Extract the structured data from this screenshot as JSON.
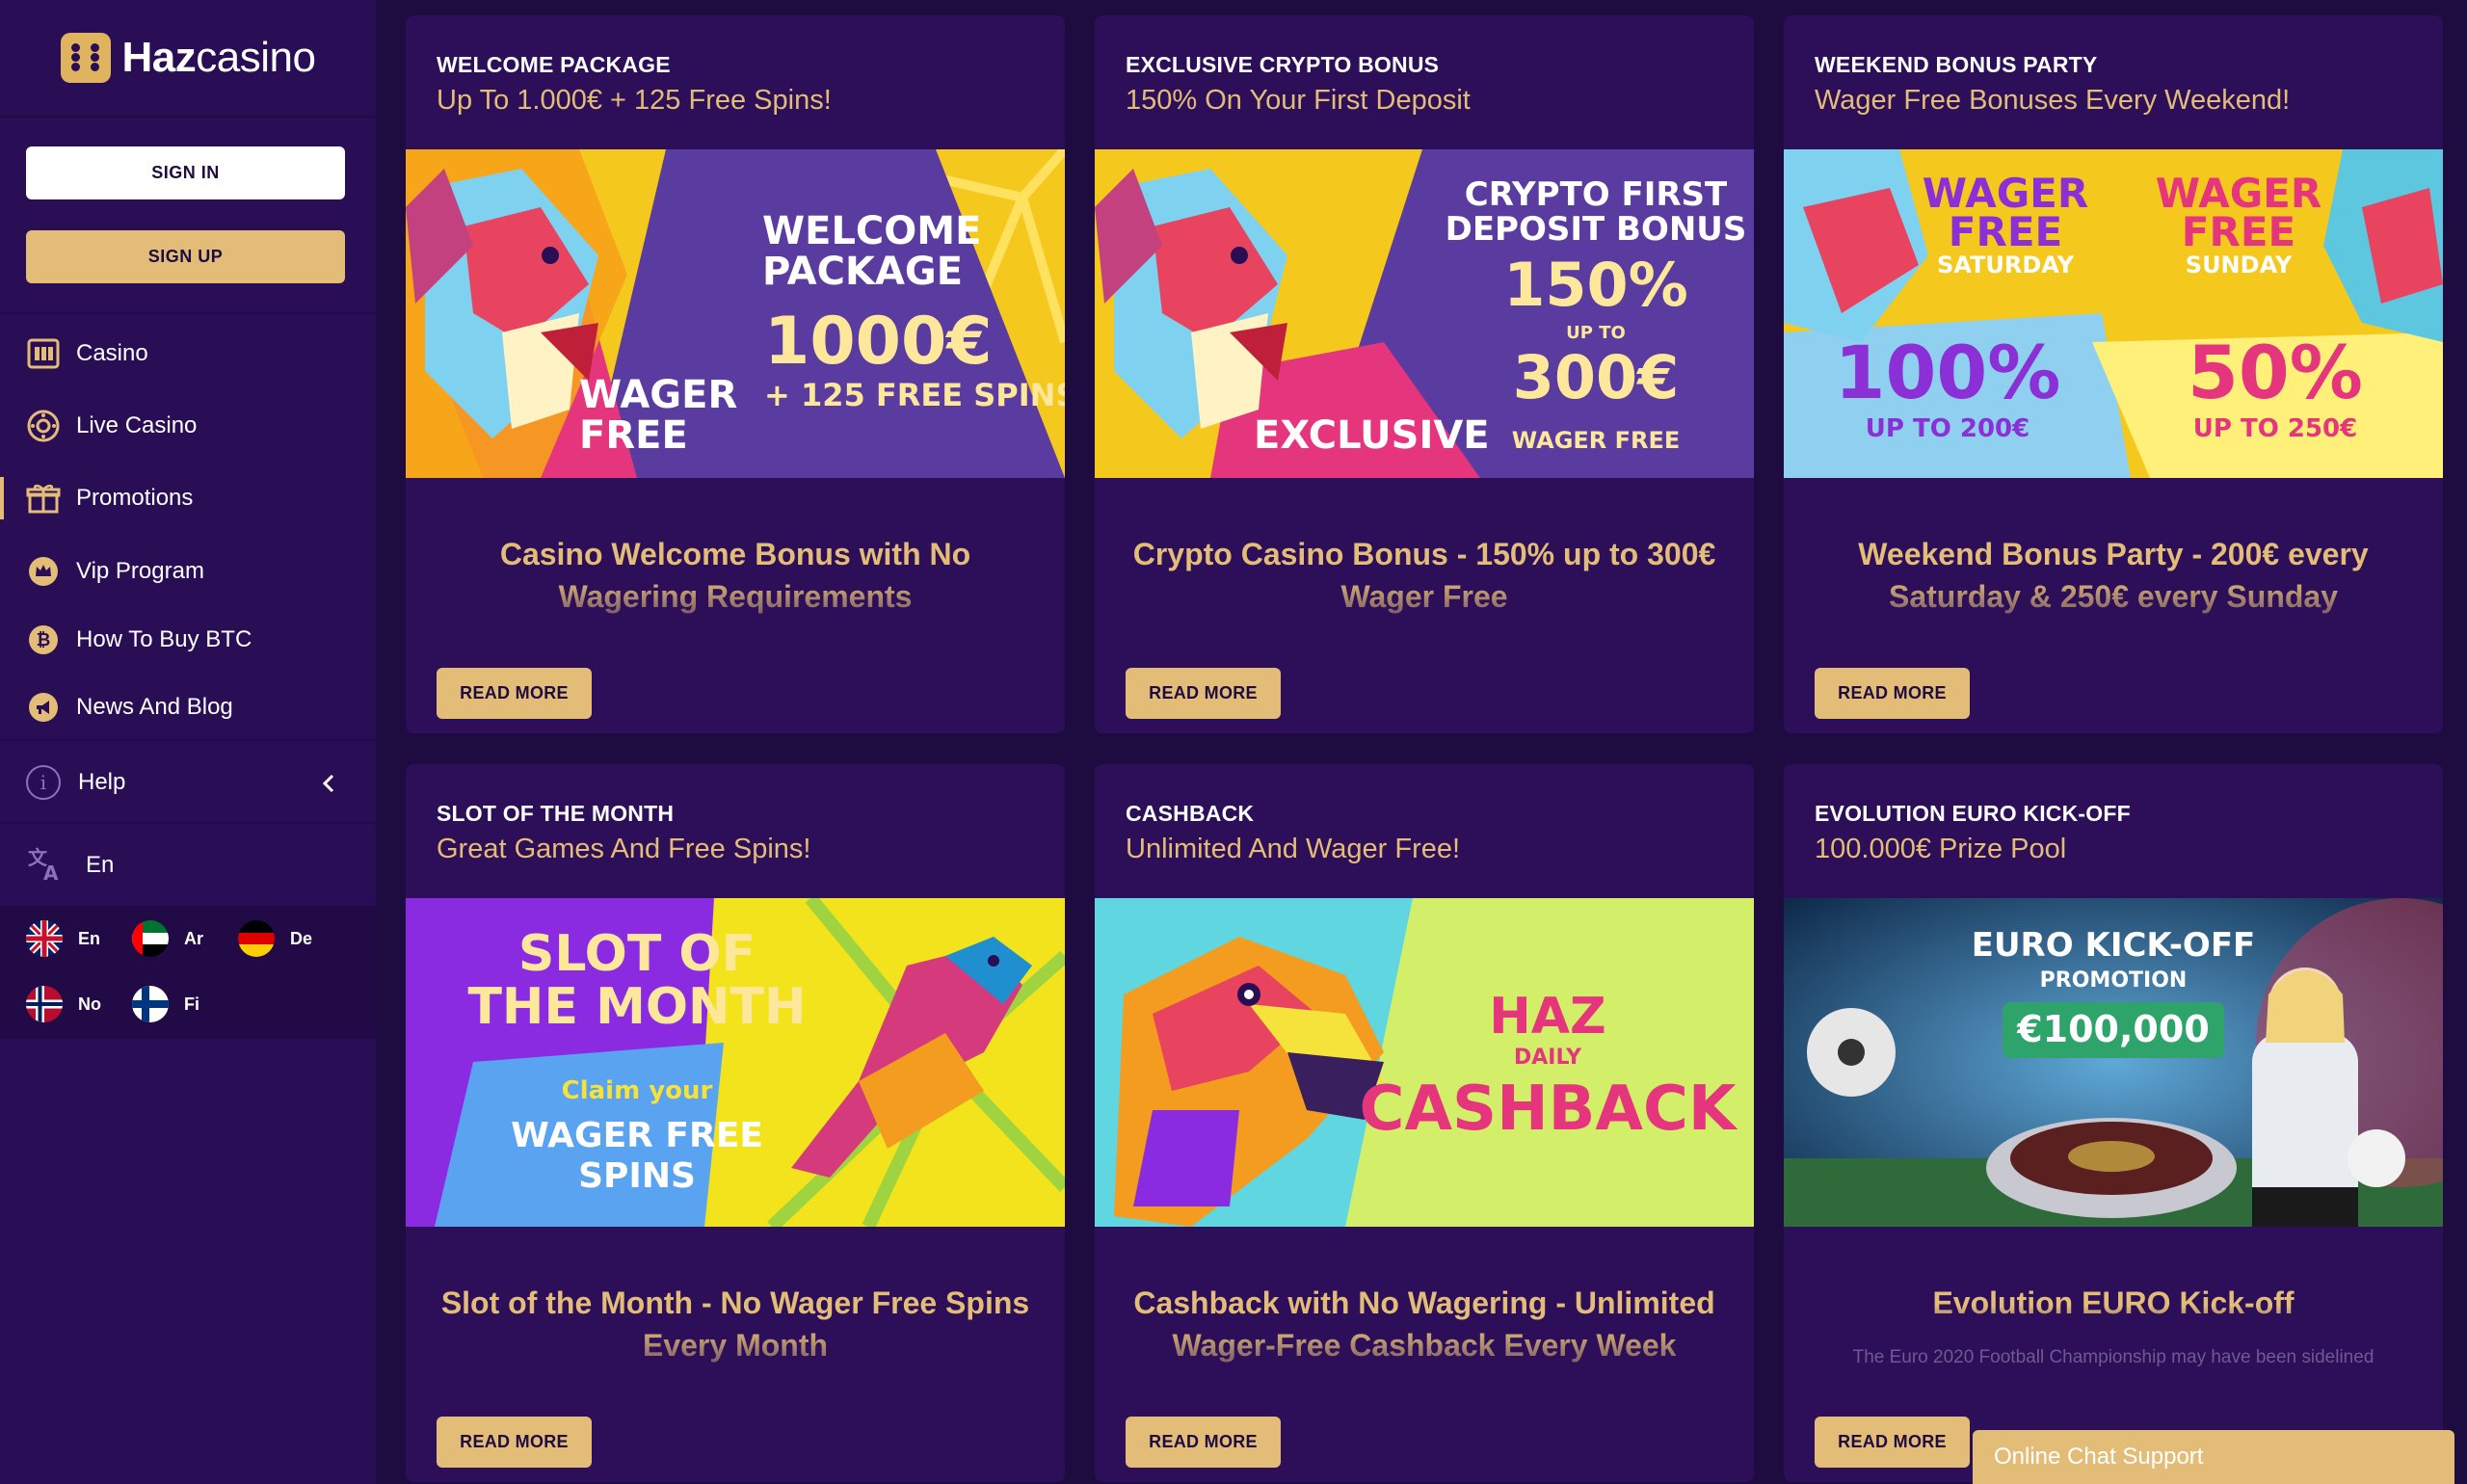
{
  "brand": {
    "name_bold": "Haz",
    "name_light": "casino"
  },
  "auth": {
    "signin": "SIGN IN",
    "signup": "SIGN UP"
  },
  "nav": [
    {
      "label": "Casino",
      "icon": "slot-machine-icon"
    },
    {
      "label": "Live Casino",
      "icon": "roulette-icon"
    },
    {
      "label": "Promotions",
      "icon": "gift-icon",
      "active": true
    },
    {
      "label": "Vip Program",
      "icon": "crown-icon"
    },
    {
      "label": "How To Buy BTC",
      "icon": "bitcoin-icon"
    },
    {
      "label": "News And Blog",
      "icon": "megaphone-icon"
    }
  ],
  "help": {
    "label": "Help",
    "icon_glyph": "i"
  },
  "language": {
    "current": "En"
  },
  "languages": [
    "En",
    "Ar",
    "De",
    "No",
    "Fi"
  ],
  "cards": [
    {
      "label": "WELCOME PACKAGE",
      "subtitle": "Up To 1.000€ + 125 Free Spins!",
      "banner": {
        "l1": "WELCOME",
        "l2": "PACKAGE",
        "l3": "1000€",
        "l4": "+ 125 FREE SPINS",
        "l5": "WAGER",
        "l6": "FREE"
      },
      "title": "Casino Welcome Bonus with No Wagering Requirements",
      "desc": "",
      "button": "READ MORE"
    },
    {
      "label": "EXCLUSIVE CRYPTO BONUS",
      "subtitle": "150% On Your First Deposit",
      "banner": {
        "l1": "CRYPTO FIRST",
        "l2": "DEPOSIT BONUS",
        "l3": "150%",
        "l4": "UP TO",
        "l5": "300€",
        "l6": "WAGER FREE",
        "l7": "EXCLUSIVE"
      },
      "title": "Crypto Casino Bonus - 150% up to 300€ Wager Free",
      "desc": "",
      "button": "READ MORE"
    },
    {
      "label": "WEEKEND BONUS PARTY",
      "subtitle": "Wager Free Bonuses Every Weekend!",
      "banner": {
        "l1": "WAGER",
        "l2": "FREE",
        "l3": "SATURDAY",
        "l4": "SUNDAY",
        "l5": "100%",
        "l6": "UP TO 200€",
        "l7": "50%",
        "l8": "UP TO 250€"
      },
      "title": "Weekend Bonus Party - 200€ every Saturday & 250€ every Sunday",
      "desc": "",
      "button": "READ MORE"
    },
    {
      "label": "SLOT OF THE MONTH",
      "subtitle": "Great Games And Free Spins!",
      "banner": {
        "l1": "SLOT OF",
        "l2": "THE MONTH",
        "l3": "Claim your",
        "l4": "WAGER FREE",
        "l5": "SPINS"
      },
      "title": "Slot of the Month - No Wager Free Spins Every Month",
      "desc": "",
      "button": "READ MORE"
    },
    {
      "label": "CASHBACK",
      "subtitle": "Unlimited And Wager Free!",
      "banner": {
        "l1": "HAZ",
        "l2": "DAILY",
        "l3": "CASHBACK"
      },
      "title": "Cashback with No Wagering - Unlimited Wager-Free Cashback Every Week",
      "desc": "",
      "button": "READ MORE"
    },
    {
      "label": "EVOLUTION EURO KICK-OFF",
      "subtitle": "100.000€ Prize Pool",
      "banner": {
        "l1": "EURO KICK-OFF",
        "l2": "PROMOTION",
        "l3": "€100,000"
      },
      "title": "Evolution EURO Kick-off",
      "desc": "The Euro 2020 Football Championship may have been sidelined",
      "button": "READ MORE"
    }
  ],
  "chat": {
    "label": "Online Chat Support"
  },
  "colors": {
    "accent": "#e3bd77",
    "sidebar": "#2a0e55",
    "background": "#1e0b40",
    "card": "#2c0f58"
  }
}
